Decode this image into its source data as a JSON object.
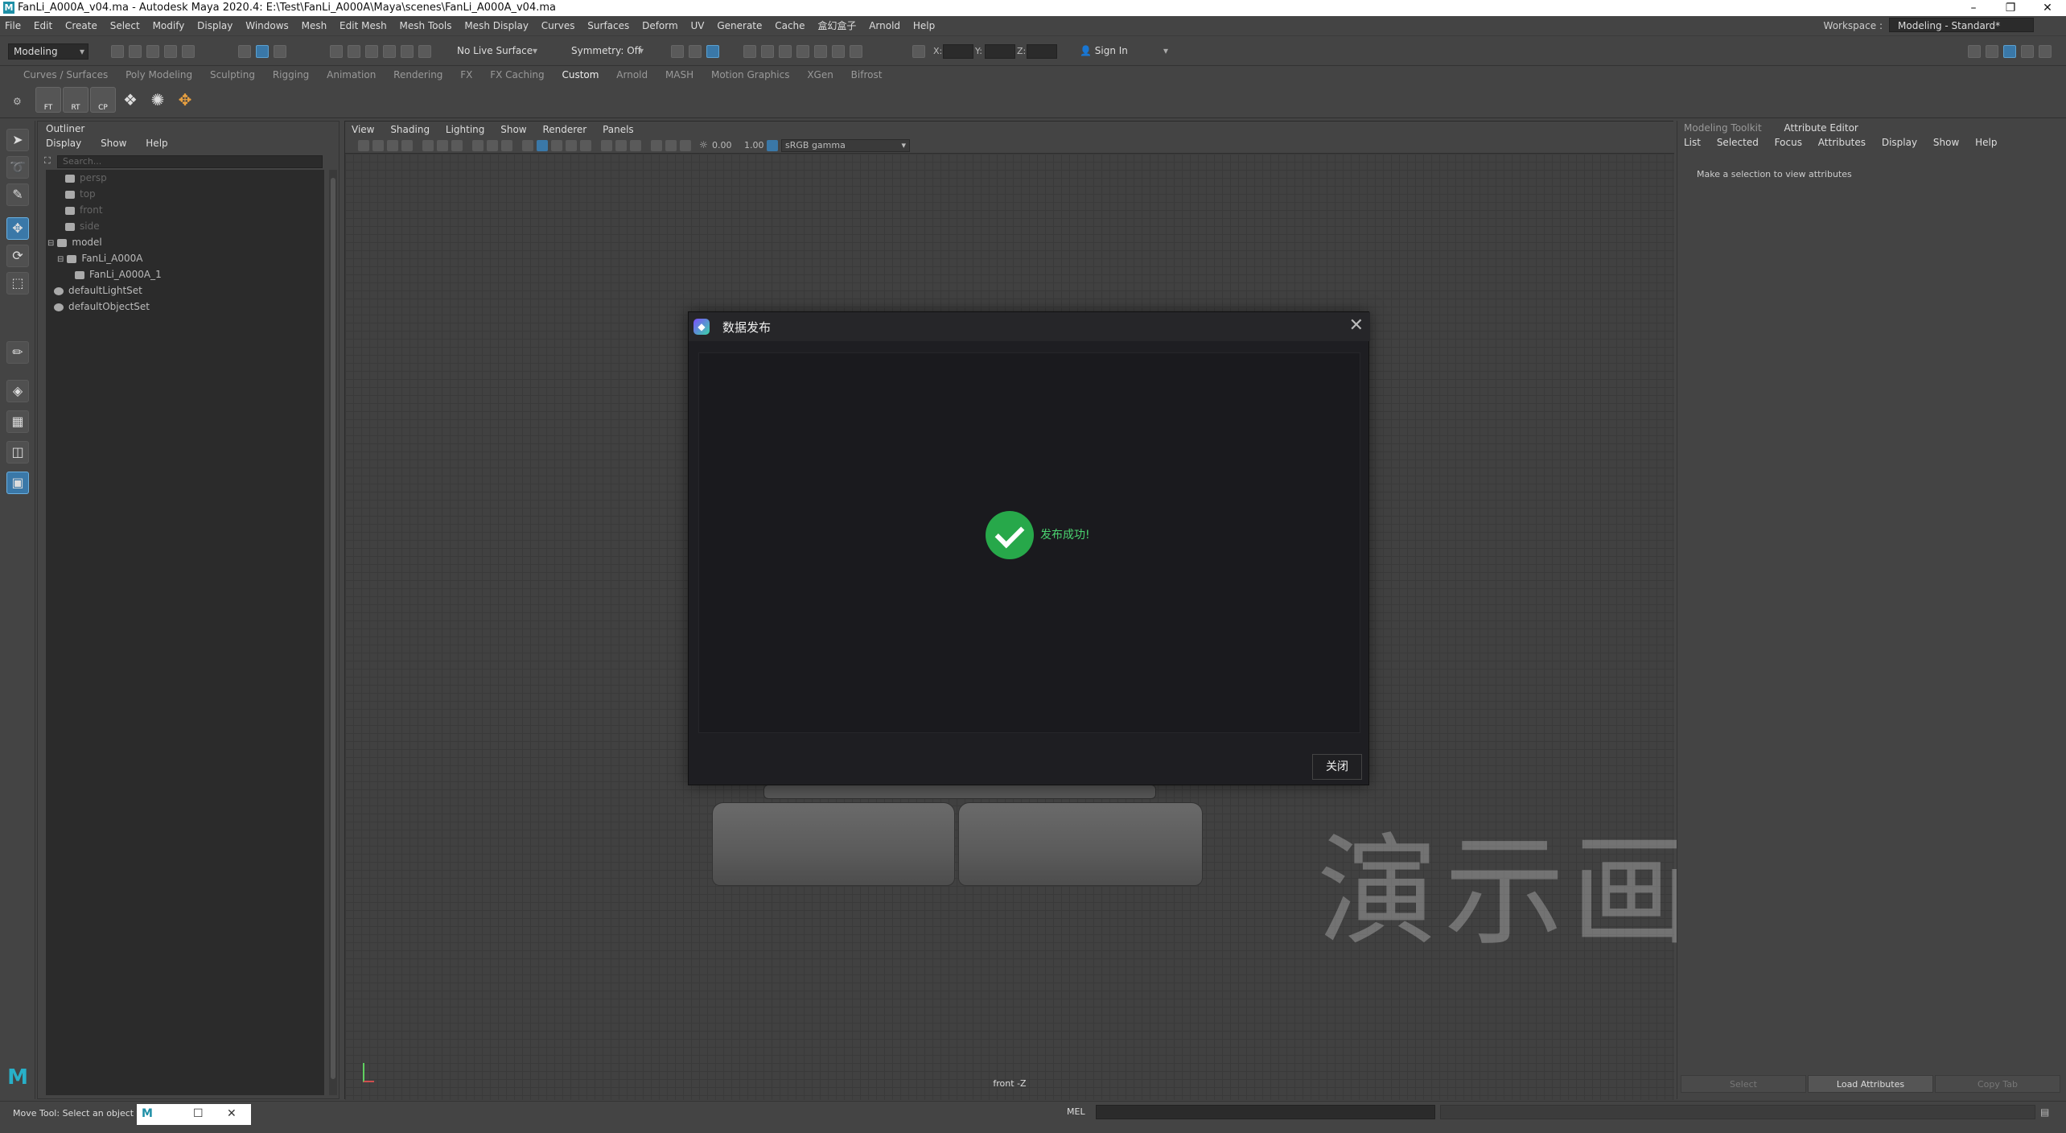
{
  "titlebar": {
    "title": "FanLi_A000A_v04.ma - Autodesk Maya 2020.4: E:\\Test\\FanLi_A000A\\Maya\\scenes\\FanLi_A000A_v04.ma",
    "logo": "M",
    "minimize": "–",
    "restore": "❐",
    "close": "✕"
  },
  "menubar": {
    "items": [
      "File",
      "Edit",
      "Create",
      "Select",
      "Modify",
      "Display",
      "Windows",
      "Mesh",
      "Edit Mesh",
      "Mesh Tools",
      "Mesh Display",
      "Curves",
      "Surfaces",
      "Deform",
      "UV",
      "Generate",
      "Cache",
      "盒幻盒子",
      "Arnold",
      "Help"
    ],
    "workspace_label": "Workspace :",
    "workspace_value": "Modeling - Standard*"
  },
  "statusline": {
    "mode": "Modeling",
    "live_surface": "No Live Surface",
    "symmetry": "Symmetry: Off",
    "x_label": "X:",
    "y_label": "Y:",
    "z_label": "Z:",
    "sign_in": "Sign In"
  },
  "shelf": {
    "tabs": [
      "Curves / Surfaces",
      "Poly Modeling",
      "Sculpting",
      "Rigging",
      "Animation",
      "Rendering",
      "FX",
      "FX Caching",
      "Custom",
      "Arnold",
      "MASH",
      "Motion Graphics",
      "XGen",
      "Bifrost"
    ],
    "active_tab": "Custom",
    "buttons": [
      "FT",
      "RT",
      "CP"
    ]
  },
  "outliner": {
    "title": "Outliner",
    "menu": [
      "Display",
      "Show",
      "Help"
    ],
    "search_placeholder": "Search...",
    "nodes": [
      "persp",
      "top",
      "front",
      "side",
      "model",
      "FanLi_A000A",
      "FanLi_A000A_1",
      "defaultLightSet",
      "defaultObjectSet"
    ]
  },
  "viewport": {
    "menu": [
      "View",
      "Shading",
      "Lighting",
      "Show",
      "Renderer",
      "Panels"
    ],
    "exposure": "0.00",
    "gamma": "1.00",
    "color_space": "sRGB gamma",
    "camera_label": "front -Z"
  },
  "dialog": {
    "title": "数据发布",
    "logo": "◆",
    "close_icon": "✕",
    "message": "发布成功!",
    "close_button": "关闭",
    "success_color": "#27a84a"
  },
  "watermark": "演示画面",
  "rightpanel": {
    "tabs": [
      "Modeling Toolkit",
      "Attribute Editor"
    ],
    "active_tab": "Attribute Editor",
    "menu": [
      "List",
      "Selected",
      "Focus",
      "Attributes",
      "Display",
      "Show",
      "Help"
    ],
    "message": "Make a selection to view attributes",
    "buttons": [
      "Select",
      "Load Attributes",
      "Copy Tab"
    ]
  },
  "cmdline": {
    "help": "Move Tool: Select an object to m",
    "mel": "MEL"
  },
  "colors": {
    "accent": "#3a78a8",
    "background": "#444444",
    "dialog_bg": "#1e1e22"
  }
}
